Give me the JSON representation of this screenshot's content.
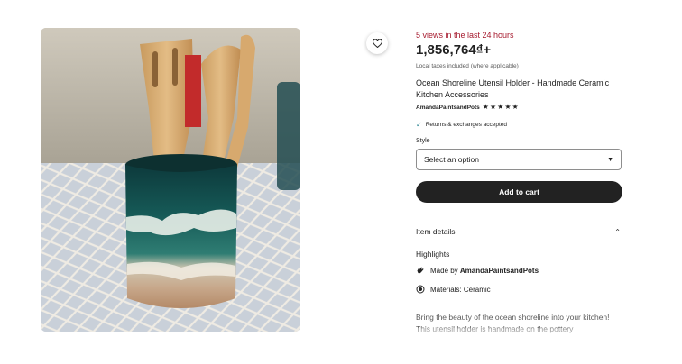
{
  "image": {
    "alt": "Ocean shoreline ceramic utensil holder with wooden spoons"
  },
  "favorite": {
    "icon": "heart-icon"
  },
  "listing": {
    "views_text": "5 views in the last 24 hours",
    "price": "1,856,764₫+",
    "tax_note": "Local taxes included (where applicable)",
    "title": "Ocean Shoreline Utensil Holder - Handmade Ceramic Kitchen Accessories",
    "seller": "AmandaPaintsandPots",
    "rating": 5,
    "returns": "Returns & exchanges accepted",
    "style_label": "Style",
    "style_select": "Select an option",
    "add_to_cart": "Add to cart"
  },
  "details": {
    "heading": "Item details",
    "highlights_heading": "Highlights",
    "made_by_prefix": "Made by ",
    "made_by_name": "AmandaPaintsandPots",
    "materials": "Materials: Ceramic",
    "description": "Bring the beauty of the ocean shoreline into your kitchen! This utensil holder is handmade on the pottery"
  },
  "colors": {
    "views": "#a61a2e",
    "button": "#222222",
    "check": "#1a7b8a"
  }
}
